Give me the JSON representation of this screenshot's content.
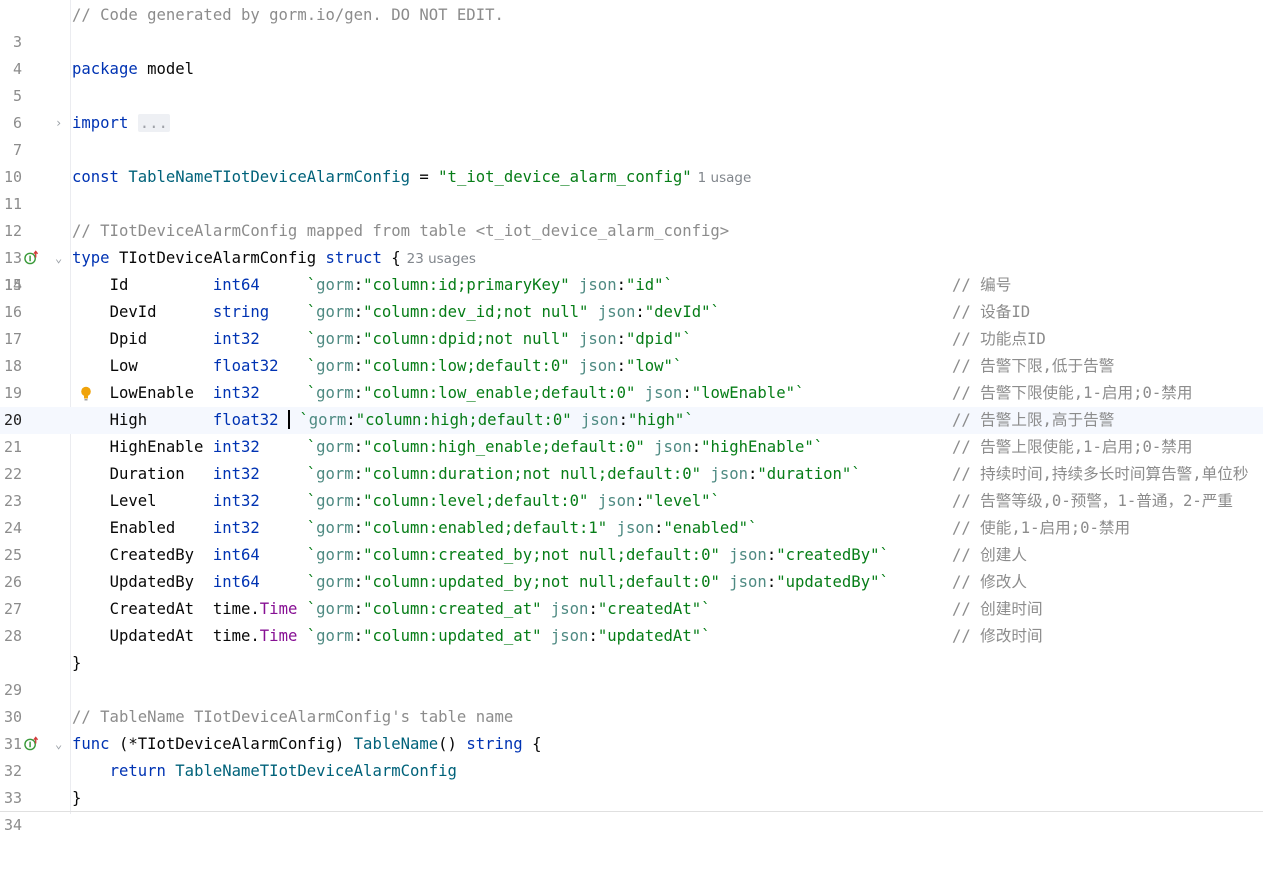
{
  "editor": {
    "line_numbers": [
      "3",
      "4",
      "5",
      "6",
      "7",
      "10",
      "11",
      "12",
      "13",
      "14",
      "15",
      "16",
      "17",
      "18",
      "19",
      "20",
      "21",
      "22",
      "23",
      "24",
      "25",
      "26",
      "27",
      "28",
      "29",
      "30",
      "31",
      "32",
      "33",
      "34"
    ],
    "header_comment": "// Code generated by gorm.io/gen. DO NOT EDIT.",
    "package_kw": "package",
    "package_name": "model",
    "import_kw": "import",
    "import_fold": "...",
    "const_kw": "const",
    "const_name": "TableNameTIotDeviceAlarmConfig",
    "const_eq": "=",
    "const_value": "\"t_iot_device_alarm_config\"",
    "const_hint": "1 usage",
    "struct_comment": "// TIotDeviceAlarmConfig mapped from table <t_iot_device_alarm_config>",
    "type_kw": "type",
    "struct_name": "TIotDeviceAlarmConfig",
    "struct_kw": "struct",
    "brace_open": "{",
    "struct_hint": "23 usages",
    "brace_close": "}",
    "fields": [
      {
        "name": "Id",
        "type_pkg": "",
        "type": "int64",
        "tag_k1": "gorm",
        "tag_v1": "\"column:id;primaryKey\"",
        "tag_k2": "json",
        "tag_v2": "\"id\"",
        "comment": "// 编号"
      },
      {
        "name": "DevId",
        "type_pkg": "",
        "type": "string",
        "tag_k1": "gorm",
        "tag_v1": "\"column:dev_id;not null\"",
        "tag_k2": "json",
        "tag_v2": "\"devId\"",
        "comment": "// 设备ID"
      },
      {
        "name": "Dpid",
        "type_pkg": "",
        "type": "int32",
        "tag_k1": "gorm",
        "tag_v1": "\"column:dpid;not null\"",
        "tag_k2": "json",
        "tag_v2": "\"dpid\"",
        "comment": "// 功能点ID"
      },
      {
        "name": "Low",
        "type_pkg": "",
        "type": "float32",
        "tag_k1": "gorm",
        "tag_v1": "\"column:low;default:0\"",
        "tag_k2": "json",
        "tag_v2": "\"low\"",
        "comment": "// 告警下限,低于告警"
      },
      {
        "name": "LowEnable",
        "type_pkg": "",
        "type": "int32",
        "tag_k1": "gorm",
        "tag_v1": "\"column:low_enable;default:0\"",
        "tag_k2": "json",
        "tag_v2": "\"lowEnable\"",
        "comment": "// 告警下限使能,1-启用;0-禁用"
      },
      {
        "name": "High",
        "type_pkg": "",
        "type": "float32",
        "tag_k1": "gorm",
        "tag_v1": "\"column:high;default:0\"",
        "tag_k2": "json",
        "tag_v2": "\"high\"",
        "comment": "// 告警上限,高于告警"
      },
      {
        "name": "HighEnable",
        "type_pkg": "",
        "type": "int32",
        "tag_k1": "gorm",
        "tag_v1": "\"column:high_enable;default:0\"",
        "tag_k2": "json",
        "tag_v2": "\"highEnable\"",
        "comment": "// 告警上限使能,1-启用;0-禁用"
      },
      {
        "name": "Duration",
        "type_pkg": "",
        "type": "int32",
        "tag_k1": "gorm",
        "tag_v1": "\"column:duration;not null;default:0\"",
        "tag_k2": "json",
        "tag_v2": "\"duration\"",
        "comment": "// 持续时间,持续多长时间算告警,单位秒"
      },
      {
        "name": "Level",
        "type_pkg": "",
        "type": "int32",
        "tag_k1": "gorm",
        "tag_v1": "\"column:level;default:0\"",
        "tag_k2": "json",
        "tag_v2": "\"level\"",
        "comment": "// 告警等级,0-预警，1-普通，2-严重"
      },
      {
        "name": "Enabled",
        "type_pkg": "",
        "type": "int32",
        "tag_k1": "gorm",
        "tag_v1": "\"column:enabled;default:1\"",
        "tag_k2": "json",
        "tag_v2": "\"enabled\"",
        "comment": "// 使能,1-启用;0-禁用"
      },
      {
        "name": "CreatedBy",
        "type_pkg": "",
        "type": "int64",
        "tag_k1": "gorm",
        "tag_v1": "\"column:created_by;not null;default:0\"",
        "tag_k2": "json",
        "tag_v2": "\"createdBy\"",
        "comment": "// 创建人"
      },
      {
        "name": "UpdatedBy",
        "type_pkg": "",
        "type": "int64",
        "tag_k1": "gorm",
        "tag_v1": "\"column:updated_by;not null;default:0\"",
        "tag_k2": "json",
        "tag_v2": "\"updatedBy\"",
        "comment": "// 修改人"
      },
      {
        "name": "CreatedAt",
        "type_pkg": "time.",
        "type": "Time",
        "tag_k1": "gorm",
        "tag_v1": "\"column:created_at\"",
        "tag_k2": "json",
        "tag_v2": "\"createdAt\"",
        "comment": "// 创建时间"
      },
      {
        "name": "UpdatedAt",
        "type_pkg": "time.",
        "type": "Time",
        "tag_k1": "gorm",
        "tag_v1": "\"column:updated_at\"",
        "tag_k2": "json",
        "tag_v2": "\"updatedAt\"",
        "comment": "// 修改时间"
      }
    ],
    "func_comment": "// TableName TIotDeviceAlarmConfig's table name",
    "func_kw": "func",
    "func_recv_open": "(*",
    "func_recv_type": "TIotDeviceAlarmConfig",
    "func_recv_close": ")",
    "func_name": "TableName",
    "func_parens": "()",
    "func_ret": "string",
    "return_kw": "return",
    "return_value": "TableNameTIotDeviceAlarmConfig",
    "current_line": "20",
    "colors": {
      "keyword": "#0033b3",
      "comment": "#8c8c8c",
      "string": "#067d17",
      "constant": "#00627a",
      "field_type": "#871094",
      "current_line_bg": "#f5f8fe"
    },
    "icons": [
      "implements-up-arrow-icon",
      "fold-chevron-icon",
      "lightbulb-icon"
    ]
  }
}
